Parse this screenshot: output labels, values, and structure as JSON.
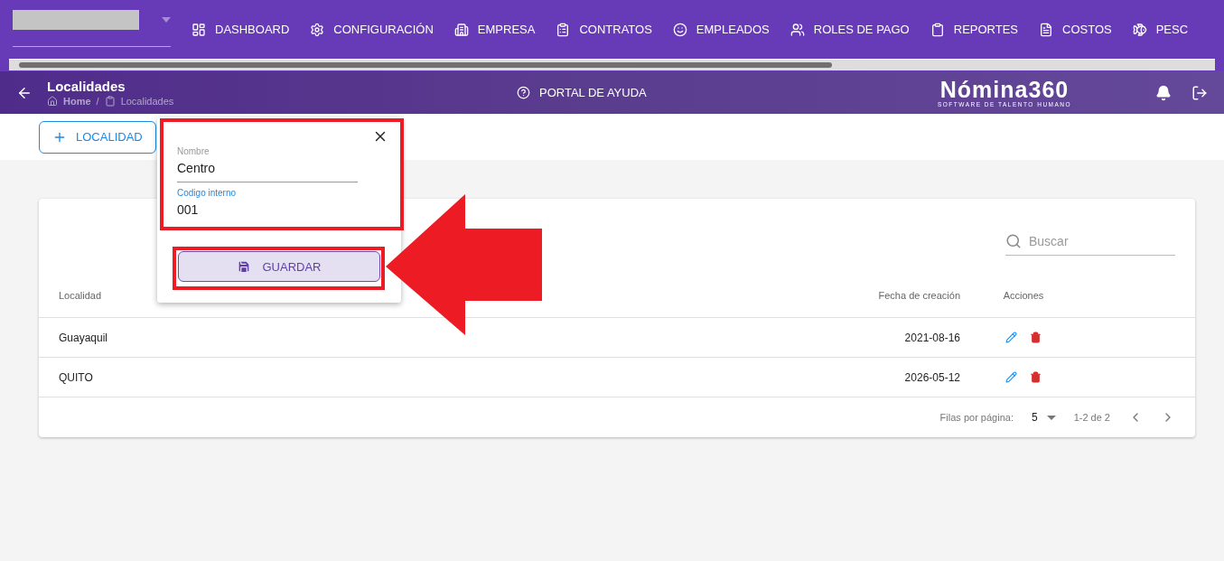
{
  "nav": [
    {
      "label": "DASHBOARD",
      "kind": "dashboard"
    },
    {
      "label": "CONFIGURACIÓN",
      "kind": "settings"
    },
    {
      "label": "EMPRESA",
      "kind": "building"
    },
    {
      "label": "CONTRATOS",
      "kind": "clipboard"
    },
    {
      "label": "EMPLEADOS",
      "kind": "face"
    },
    {
      "label": "ROLES DE PAGO",
      "kind": "users"
    },
    {
      "label": "REPORTES",
      "kind": "report"
    },
    {
      "label": "COSTOS",
      "kind": "invoice"
    },
    {
      "label": "PESC",
      "kind": "fish"
    }
  ],
  "header": {
    "title": "Localidades",
    "breadcrumb": [
      "Home",
      "Localidades"
    ],
    "breadcrumb_separator": "/",
    "help": "PORTAL DE AYUDA",
    "logo": "Nómina360",
    "logo_tagline": "SOFTWARE DE TALENTO HUMANO"
  },
  "add_button": "LOCALIDAD",
  "popup": {
    "fields": [
      {
        "label": "Nombre",
        "value": "Centro",
        "focused": false
      },
      {
        "label": "Codigo interno",
        "value": "001",
        "focused": true
      }
    ],
    "save": "GUARDAR"
  },
  "search": {
    "placeholder": "Buscar"
  },
  "table": {
    "columns": [
      "Localidad",
      "Fecha de creación",
      "Acciones"
    ],
    "rows": [
      {
        "name": "Guayaquil",
        "date": "2021-08-16"
      },
      {
        "name": "QUITO",
        "date": "2026-05-12"
      }
    ]
  },
  "pagination": {
    "label": "Filas por página:",
    "per_page": "5",
    "range": "1-2 de 2"
  }
}
